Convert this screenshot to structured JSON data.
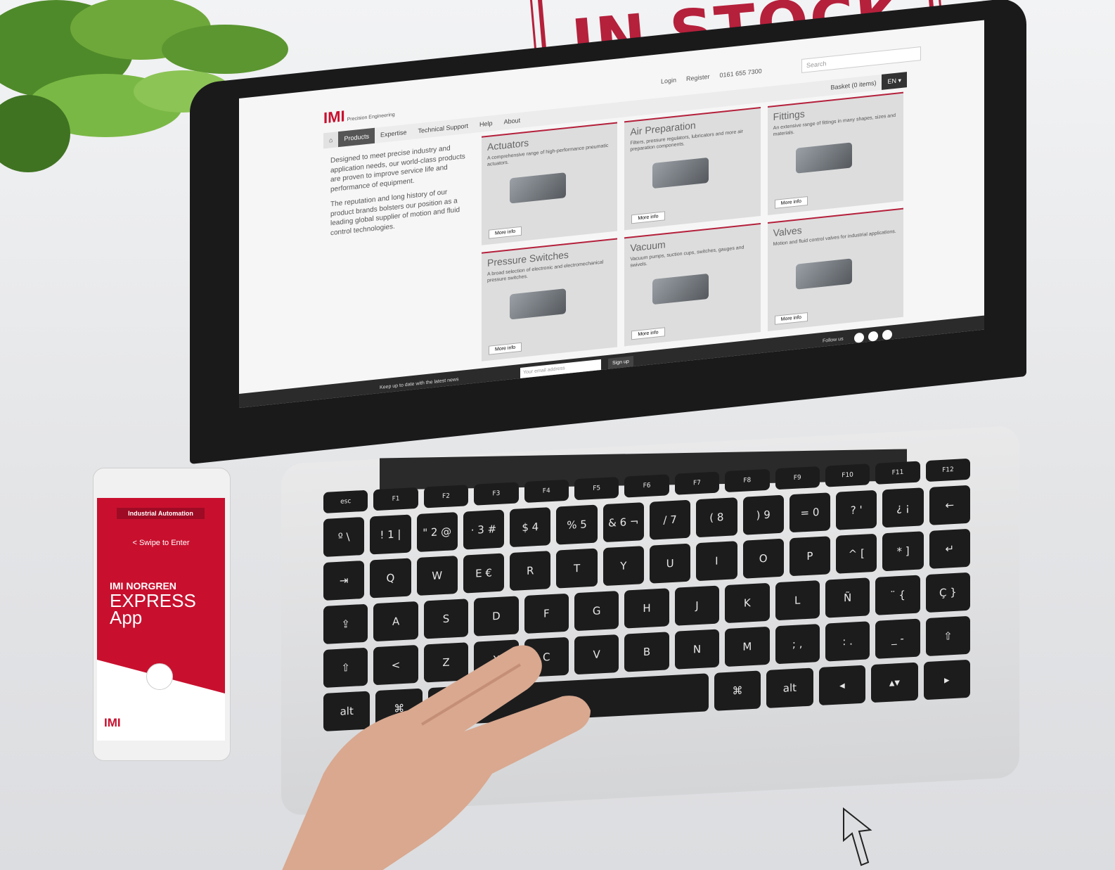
{
  "stamp": {
    "text": "IN STOCK"
  },
  "website": {
    "logo": "IMI",
    "logo_sub": "Precision Engineering",
    "util": {
      "login": "Login",
      "register": "Register",
      "phone": "0161 655 7300"
    },
    "search_placeholder": "Search",
    "nav": {
      "home": "⌂",
      "items": [
        "Products",
        "Expertise",
        "Technical Support",
        "Help",
        "About"
      ],
      "basket": "Basket (0 items)",
      "lang": "EN ▾"
    },
    "intro": [
      "Designed to meet precise industry and application needs, our world-class products are proven to improve service life and performance of equipment.",
      "The reputation and long history of our product brands bolsters our position as a leading global supplier of motion and fluid control technologies."
    ],
    "cards": [
      {
        "title": "Actuators",
        "desc": "A comprehensive range of high-performance pneumatic actuators.",
        "btn": "More info"
      },
      {
        "title": "Air Preparation",
        "desc": "Filters, pressure regulators, lubricators and more air preparation components.",
        "btn": "More info"
      },
      {
        "title": "Fittings",
        "desc": "An extensive range of fittings in many shapes, sizes and materials.",
        "btn": "More info"
      },
      {
        "title": "Pressure Switches",
        "desc": "A broad selection of electronic and electromechanical pressure switches.",
        "btn": "More info"
      },
      {
        "title": "Vacuum",
        "desc": "Vacuum pumps, suction cups, switches, gauges and swivels.",
        "btn": "More info"
      },
      {
        "title": "Valves",
        "desc": "Motion and fluid control valves for industrial applications.",
        "btn": "More info"
      }
    ],
    "footer": {
      "news": "Keep up to date with the latest news",
      "email_placeholder": "Your email address",
      "signup": "Sign up",
      "follow": "Follow us"
    }
  },
  "phone": {
    "title": "Industrial Automation",
    "swipe": "< Swipe to Enter",
    "brand_line1": "IMI NORGREN",
    "brand_line2": "EXPRESS",
    "brand_line3": "App",
    "logo": "IMI"
  },
  "keyboard": {
    "fn_row": [
      "esc",
      "F1",
      "F2",
      "F3",
      "F4",
      "F5",
      "F6",
      "F7",
      "F8",
      "F9",
      "F10",
      "F11",
      "F12"
    ],
    "num_row": [
      "º \\",
      "! 1 |",
      "\" 2 @",
      "· 3 #",
      "$ 4",
      "% 5",
      "& 6 ¬",
      "/ 7",
      "( 8",
      ") 9",
      "= 0",
      "? '",
      "¿ ¡",
      "←"
    ],
    "q_row": [
      "⇥",
      "Q",
      "W",
      "E €",
      "R",
      "T",
      "Y",
      "U",
      "I",
      "O",
      "P",
      "^ [",
      "* ]",
      "↵"
    ],
    "a_row": [
      "⇪",
      "A",
      "S",
      "D",
      "F",
      "G",
      "H",
      "J",
      "K",
      "L",
      "Ñ",
      "¨ {",
      "Ç }"
    ],
    "z_row": [
      "⇧",
      "<",
      "Z",
      "X",
      "C",
      "V",
      "B",
      "N",
      "M",
      "; ,",
      ": .",
      "_ -",
      "⇧"
    ],
    "space_row": [
      "alt",
      "⌘",
      "",
      "⌘",
      "alt",
      "◂",
      "▴▾",
      "▸"
    ]
  }
}
